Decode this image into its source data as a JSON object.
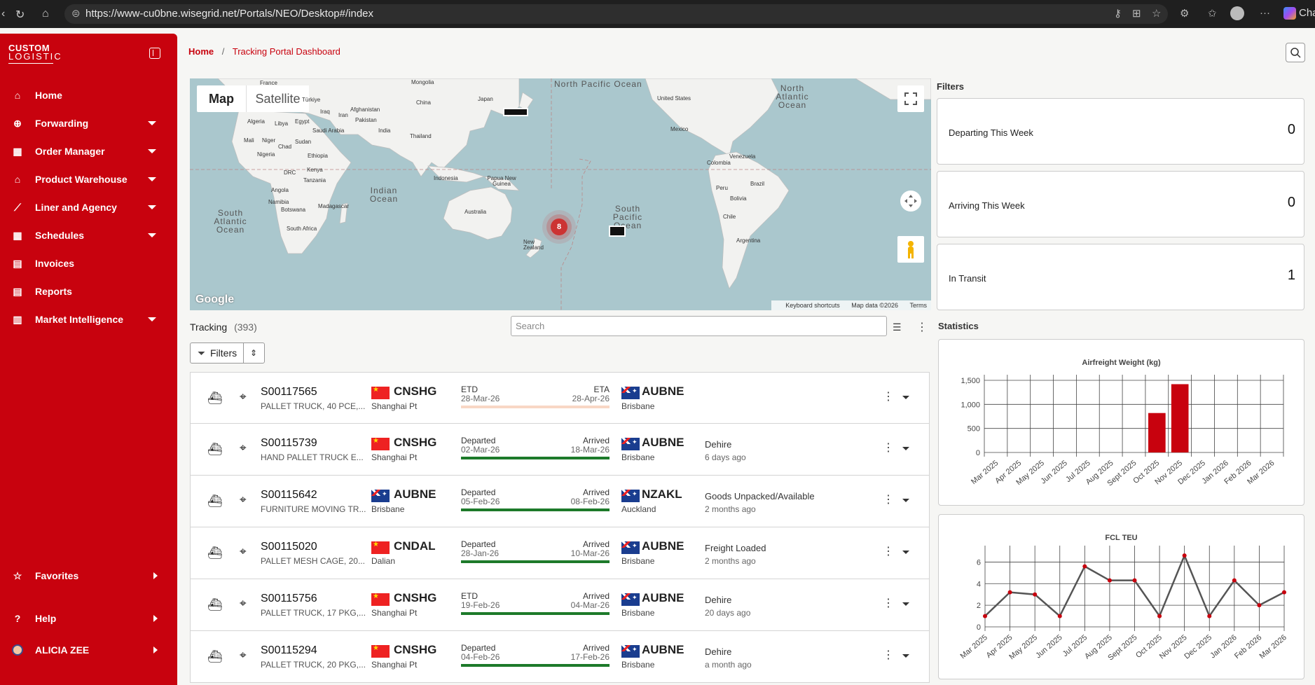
{
  "browser": {
    "url": "https://www-cu0bne.wisegrid.net/Portals/NEO/Desktop#/index",
    "tab_partial": "Cha"
  },
  "sidebar": {
    "logo_line1": "CUSTOM",
    "logo_line2": "LOGISTIC",
    "items": [
      {
        "label": "Home",
        "icon": "home-icon",
        "expandable": false
      },
      {
        "label": "Forwarding",
        "icon": "globe-icon",
        "expandable": true
      },
      {
        "label": "Order Manager",
        "icon": "calendar-icon",
        "expandable": true
      },
      {
        "label": "Product Warehouse",
        "icon": "warehouse-icon",
        "expandable": true
      },
      {
        "label": "Liner and Agency",
        "icon": "chart-line-icon",
        "expandable": true
      },
      {
        "label": "Schedules",
        "icon": "calendar-icon",
        "expandable": true
      },
      {
        "label": "Invoices",
        "icon": "document-icon",
        "expandable": false
      },
      {
        "label": "Reports",
        "icon": "document-icon",
        "expandable": false
      },
      {
        "label": "Market Intelligence",
        "icon": "bar-chart-icon",
        "expandable": true
      }
    ],
    "bottom": [
      {
        "label": "Favorites",
        "icon": "star-icon"
      },
      {
        "label": "Help",
        "icon": "help-icon"
      },
      {
        "label": "ALICIA ZEE",
        "icon": "avatar-icon"
      }
    ]
  },
  "breadcrumb": {
    "home": "Home",
    "separator": "/",
    "current": "Tracking Portal Dashboard"
  },
  "map": {
    "tab_map": "Map",
    "tab_satellite": "Satellite",
    "cluster_count": "8",
    "google": "Google",
    "footer": {
      "shortcuts": "Keyboard shortcuts",
      "data": "Map data ©2026",
      "terms": "Terms"
    },
    "oceans": [
      {
        "name": "North Pacific Ocean"
      },
      {
        "name": "North Atlantic Ocean"
      },
      {
        "name": "South Pacific Ocean"
      },
      {
        "name": "Indian Ocean"
      },
      {
        "name": "South Atlantic Ocean"
      }
    ],
    "places": [
      "Mongolia",
      "China",
      "Japan",
      "Türkiye",
      "Afghanistan",
      "Iraq",
      "Iran",
      "Pakistan",
      "India",
      "Thailand",
      "Indonesia",
      "Papua New Guinea",
      "Australia",
      "New Zealand",
      "Algeria",
      "Libya",
      "Egypt",
      "Saudi Arabia",
      "Mali",
      "Niger",
      "Chad",
      "Sudan",
      "Nigeria",
      "Ethiopia",
      "DRC",
      "Kenya",
      "Tanzania",
      "Angola",
      "Namibia",
      "Botswana",
      "Madagascar",
      "South Africa",
      "United States",
      "Mexico",
      "Venezuela",
      "Colombia",
      "Peru",
      "Brazil",
      "Bolivia",
      "Chile",
      "Argentina",
      "France"
    ]
  },
  "tracking": {
    "title": "Tracking",
    "count": "(393)",
    "search_placeholder": "Search",
    "filters_label": "Filters",
    "rows": [
      {
        "ref": "S00117565",
        "desc": "PALLET TRUCK, 40 PCE,...",
        "orig_code": "CNSHG",
        "orig_flag": "cn",
        "orig_name": "Shanghai Pt",
        "dep_label": "ETD",
        "dep_date": "28-Mar-26",
        "arr_label": "ETA",
        "arr_date": "28-Apr-26",
        "progress": 0,
        "dest_code": "AUBNE",
        "dest_flag": "au",
        "dest_name": "Brisbane",
        "status": "",
        "ago": ""
      },
      {
        "ref": "S00115739",
        "desc": "HAND PALLET TRUCK E...",
        "orig_code": "CNSHG",
        "orig_flag": "cn",
        "orig_name": "Shanghai Pt",
        "dep_label": "Departed",
        "dep_date": "02-Mar-26",
        "arr_label": "Arrived",
        "arr_date": "18-Mar-26",
        "progress": 1,
        "dest_code": "AUBNE",
        "dest_flag": "au",
        "dest_name": "Brisbane",
        "status": "Dehire",
        "ago": "6 days ago"
      },
      {
        "ref": "S00115642",
        "desc": "FURNITURE MOVING TR...",
        "orig_code": "AUBNE",
        "orig_flag": "au",
        "orig_name": "Brisbane",
        "dep_label": "Departed",
        "dep_date": "05-Feb-26",
        "arr_label": "Arrived",
        "arr_date": "08-Feb-26",
        "progress": 1,
        "dest_code": "NZAKL",
        "dest_flag": "au",
        "dest_name": "Auckland",
        "status": "Goods Unpacked/Available",
        "ago": "2 months ago"
      },
      {
        "ref": "S00115020",
        "desc": "PALLET MESH CAGE, 20...",
        "orig_code": "CNDAL",
        "orig_flag": "cn",
        "orig_name": "Dalian",
        "dep_label": "Departed",
        "dep_date": "28-Jan-26",
        "arr_label": "Arrived",
        "arr_date": "10-Mar-26",
        "progress": 1,
        "dest_code": "AUBNE",
        "dest_flag": "au",
        "dest_name": "Brisbane",
        "status": "Freight Loaded",
        "ago": "2 months ago"
      },
      {
        "ref": "S00115756",
        "desc": "PALLET TRUCK, 17 PKG,...",
        "orig_code": "CNSHG",
        "orig_flag": "cn",
        "orig_name": "Shanghai Pt",
        "dep_label": "ETD",
        "dep_date": "19-Feb-26",
        "arr_label": "Arrived",
        "arr_date": "04-Mar-26",
        "progress": 1,
        "dest_code": "AUBNE",
        "dest_flag": "au",
        "dest_name": "Brisbane",
        "status": "Dehire",
        "ago": "20 days ago"
      },
      {
        "ref": "S00115294",
        "desc": "PALLET TRUCK, 20 PKG,...",
        "orig_code": "CNSHG",
        "orig_flag": "cn",
        "orig_name": "Shanghai Pt",
        "dep_label": "Departed",
        "dep_date": "04-Feb-26",
        "arr_label": "Arrived",
        "arr_date": "17-Feb-26",
        "progress": 1,
        "dest_code": "AUBNE",
        "dest_flag": "au",
        "dest_name": "Brisbane",
        "status": "Dehire",
        "ago": "a month ago"
      }
    ]
  },
  "filters": {
    "title": "Filters",
    "cards": [
      {
        "label": "Departing This Week",
        "value": "0"
      },
      {
        "label": "Arriving This Week",
        "value": "0"
      },
      {
        "label": "In Transit",
        "value": "1"
      }
    ]
  },
  "statistics": {
    "title": "Statistics"
  },
  "chart_data": [
    {
      "type": "bar",
      "title": "Airfreight Weight (kg)",
      "categories": [
        "Mar 2025",
        "Apr 2025",
        "May 2025",
        "Jun 2025",
        "Jul 2025",
        "Aug 2025",
        "Sept 2025",
        "Oct 2025",
        "Nov 2025",
        "Dec 2025",
        "Jan 2026",
        "Feb 2026",
        "Mar 2026"
      ],
      "values": [
        0,
        0,
        0,
        0,
        0,
        0,
        0,
        820,
        1420,
        0,
        0,
        0,
        0
      ],
      "ylim": [
        0,
        1500
      ],
      "yticks": [
        "0",
        "500",
        "1,000",
        "1,500"
      ],
      "color": "#c8020e"
    },
    {
      "type": "line",
      "title": "FCL TEU",
      "categories": [
        "Mar 2025",
        "Apr 2025",
        "May 2025",
        "Jun 2025",
        "Jul 2025",
        "Aug 2025",
        "Sept 2025",
        "Oct 2025",
        "Nov 2025",
        "Dec 2025",
        "Jan 2026",
        "Feb 2026",
        "Mar 2026"
      ],
      "values": [
        1,
        3.2,
        3,
        1,
        5.6,
        4.3,
        4.3,
        1,
        6.6,
        1,
        4.3,
        2,
        3.2
      ],
      "ylim": [
        0,
        7
      ],
      "yticks": [
        "0",
        "2",
        "4",
        "6"
      ],
      "line_color": "#555555",
      "point_color": "#c8020e"
    }
  ],
  "colors": {
    "brand": "#c8020e",
    "progress_done": "#1d7a2a",
    "progress_pending": "#f8d7c5"
  }
}
